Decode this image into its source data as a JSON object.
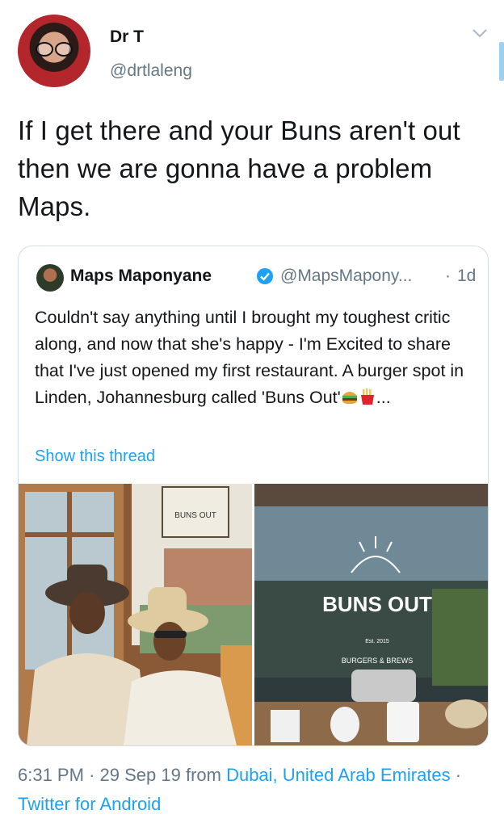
{
  "tweet": {
    "author_name": "Dr T",
    "author_handle": "@drtlaleng",
    "text": "If I get there and your Buns aren't out then we are gonna have a problem Maps."
  },
  "quoted_tweet": {
    "author_name": "Maps Maponyane",
    "author_handle": "@MapsMapony...",
    "separator": "·",
    "time_ago": "1d",
    "text": "Couldn't say anything until I brought my toughest critic along, and now that she's happy - I'm Excited to share that I've just opened my first restaurant. A burger spot in Linden, Johannesburg called 'Buns Out'",
    "text_tail": "...",
    "show_thread_label": "Show this thread",
    "photos": {
      "left_sign": "BUNS OUT",
      "right_sign_title": "BUNS OUT",
      "right_sign_est": "Est. 2015",
      "right_sign_sub": "BURGERS & BREWS"
    }
  },
  "footer": {
    "time": "6:31 PM",
    "dot": "·",
    "date": "29 Sep 19",
    "from": "from",
    "location": "Dubai, United Arab Emirates",
    "source": "Twitter for Android"
  },
  "colors": {
    "link": "#1da1f2",
    "secondary_text": "#657786",
    "border": "#d5dde2"
  },
  "icons": [
    "chevron-down-icon",
    "verified-badge-icon",
    "burger-emoji-icon",
    "fries-emoji-icon"
  ]
}
